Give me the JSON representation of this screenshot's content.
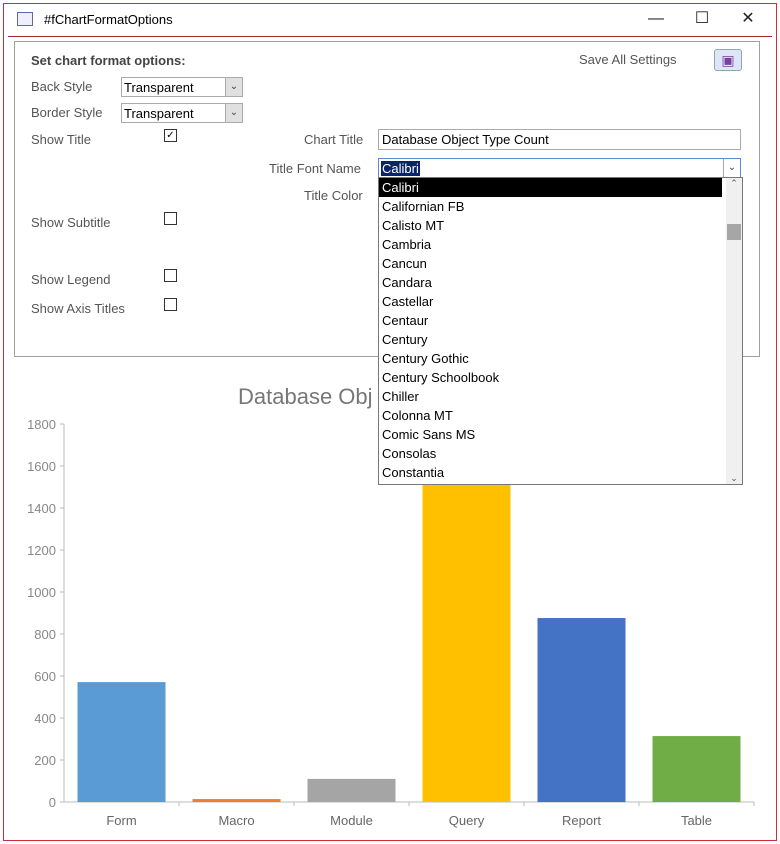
{
  "window": {
    "title": "#fChartFormatOptions",
    "minimize": "—",
    "maximize": "☐",
    "close": "✕"
  },
  "form": {
    "heading": "Set chart format options:",
    "save_label": "Save All Settings",
    "back_style": {
      "label": "Back Style",
      "value": "Transparent"
    },
    "border_style": {
      "label": "Border Style",
      "value": "Transparent"
    },
    "show_title": {
      "label": "Show Title",
      "checked": true,
      "mark": "✓"
    },
    "show_subtitle": {
      "label": "Show Subtitle",
      "checked": false
    },
    "show_legend": {
      "label": "Show Legend",
      "checked": false
    },
    "show_axis_titles": {
      "label": "Show Axis Titles",
      "checked": false
    },
    "chart_title": {
      "label": "Chart Title",
      "value": "Database Object Type Count"
    },
    "title_font": {
      "label": "Title Font Name",
      "value": "Calibri"
    },
    "title_color": {
      "label": "Title Color"
    },
    "font_options": [
      "Calibri",
      "Californian FB",
      "Calisto MT",
      "Cambria",
      "Cancun",
      "Candara",
      "Castellar",
      "Centaur",
      "Century",
      "Century Gothic",
      "Century Schoolbook",
      "Chiller",
      "Colonna MT",
      "Comic Sans MS",
      "Consolas",
      "Constantia"
    ]
  },
  "chart_data": {
    "type": "bar",
    "title": "Database Object Type Count",
    "title_visible": "Database Obj",
    "categories": [
      "Form",
      "Macro",
      "Module",
      "Query",
      "Report",
      "Table"
    ],
    "values": [
      571,
      14,
      110,
      1600,
      876,
      314
    ],
    "colors": [
      "#5b9bd5",
      "#ed7d31",
      "#a5a5a5",
      "#ffc000",
      "#4472c4",
      "#70ad47"
    ],
    "ylim": [
      0,
      1800
    ],
    "yticks": [
      "0",
      "200",
      "400",
      "600",
      "800",
      "1000",
      "1200",
      "1400",
      "1600",
      "1800"
    ],
    "grid": false
  }
}
